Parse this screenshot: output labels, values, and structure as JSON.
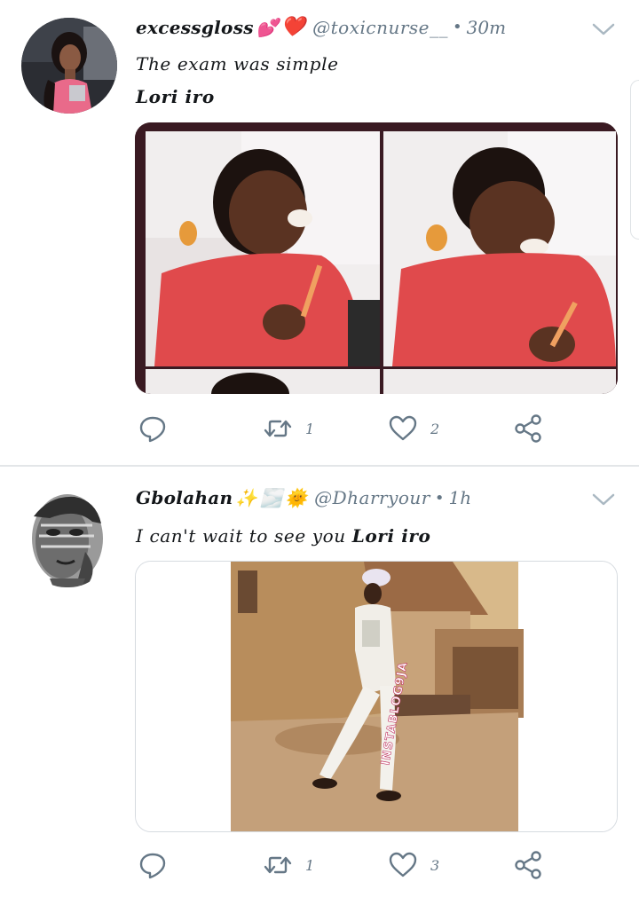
{
  "tweets": [
    {
      "name": "excessgloss",
      "name_emoji": [
        "💕",
        "❤️"
      ],
      "handle": "@toxicnurse__",
      "separator": "•",
      "time": "30m",
      "lines": [
        "The exam was simple",
        "Lori iro"
      ],
      "media_icon": "meme-image-two-panel-laughing-boy",
      "replies": "",
      "retweets": "1",
      "likes": "2"
    },
    {
      "name": "Gbolahan",
      "name_emoji": [
        "✨",
        "🌫️",
        "🌞"
      ],
      "handle": "@Dharryour",
      "separator": "•",
      "time": "1h",
      "line_prefix": "I can't wait to see you ",
      "line_bold": "Lori iro",
      "media_icon": "video-still-man-walking-white-outfit",
      "watermark": "INSTABLOG9JA",
      "replies": "",
      "retweets": "1",
      "likes": "3"
    }
  ],
  "colors": {
    "text": "#14171a",
    "secondary": "#657786",
    "divider": "#e3e6e8",
    "heart": "#e0245e"
  },
  "icons": [
    "reply-icon",
    "retweet-icon",
    "like-icon",
    "share-icon",
    "chevron-down-icon"
  ]
}
